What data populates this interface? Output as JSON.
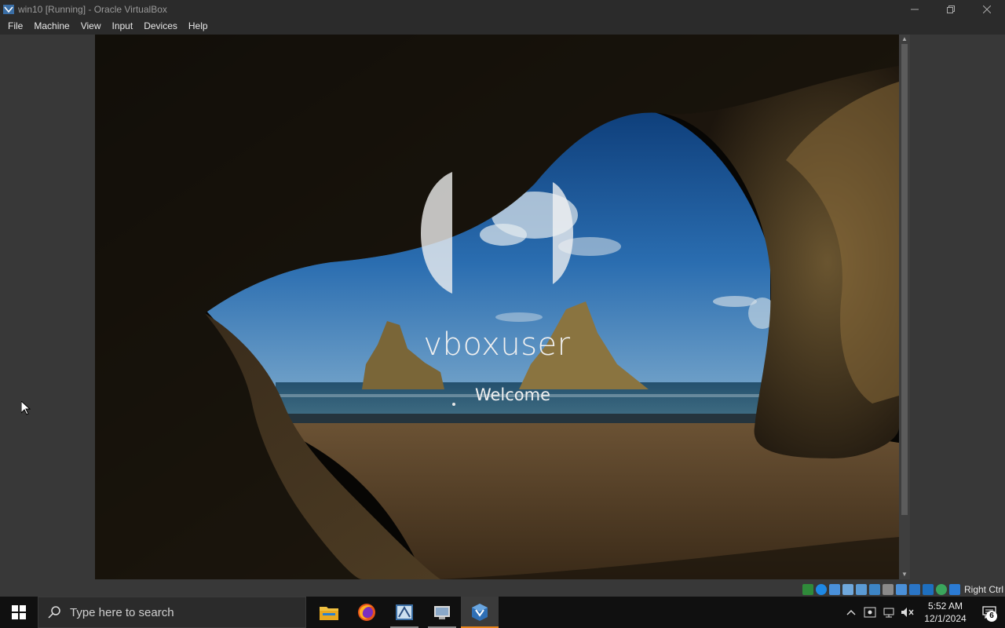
{
  "window": {
    "title": "win10 [Running] - Oracle VirtualBox",
    "controls": [
      "minimize",
      "restore",
      "close"
    ]
  },
  "menu": {
    "items": [
      "File",
      "Machine",
      "View",
      "Input",
      "Devices",
      "Help"
    ]
  },
  "vm_screen": {
    "username": "vboxuser",
    "status": "Welcome",
    "background": "cave-beach-wallpaper"
  },
  "statusbar": {
    "icons": [
      "hard-disk-icon",
      "optical-drive-icon",
      "floppy-icon",
      "audio-icon",
      "network-icon",
      "usb-icon",
      "shared-folders-icon",
      "display-icon",
      "video-capture-icon",
      "virtualization-icon",
      "mouse-integration-icon",
      "keyboard-icon"
    ],
    "host_key": "Right Ctrl"
  },
  "taskbar": {
    "search_placeholder": "Type here to search",
    "apps": [
      "file-explorer-icon",
      "firefox-icon",
      "app-icon-3",
      "app-icon-4",
      "virtualbox-icon"
    ],
    "clock_time": "5:52 AM",
    "clock_date": "12/1/2024",
    "notification_count": "6"
  },
  "colors": {
    "taskbar_accent": "#e8841a",
    "title_bar": "#2b2b2b"
  }
}
